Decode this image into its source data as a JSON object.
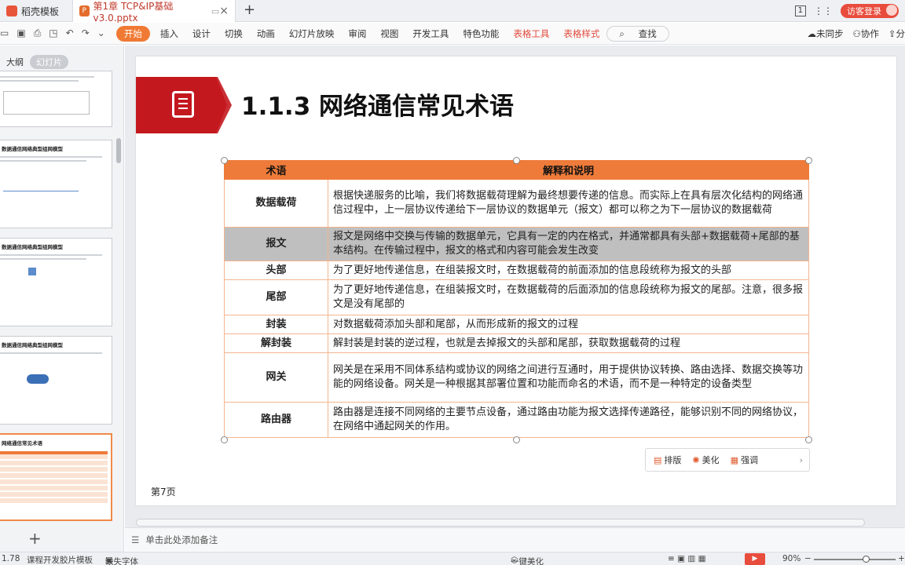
{
  "tabs": [
    {
      "label": "稻壳模板"
    },
    {
      "label": "第1章 TCP&IP基础v3.0.pptx",
      "icon_text": "P"
    }
  ],
  "window": {
    "page_indicator": "1",
    "login_label": "访客登录"
  },
  "ribbon": {
    "start": "开始",
    "menus": [
      "插入",
      "设计",
      "切换",
      "动画",
      "幻灯片放映",
      "审阅",
      "视图",
      "开发工具",
      "特色功能"
    ],
    "context_tabs": [
      "表格工具",
      "表格样式"
    ],
    "search": "查找",
    "right": [
      "未同步",
      "协作",
      "分"
    ]
  },
  "left_panel": {
    "tabs": [
      "大纲",
      "幻灯片"
    ],
    "thumbnails": [
      {
        "title": ""
      },
      {
        "title": "数据通信网络典型组网模型"
      },
      {
        "title": "数据通信网络典型组网模型"
      },
      {
        "title": "数据通信网络典型组网模型"
      },
      {
        "title": "网络通信常见术语"
      }
    ]
  },
  "slide": {
    "title": "1.1.3 网络通信常见术语",
    "page_label": "第7页",
    "table": {
      "headers": [
        "术语",
        "解释和说明"
      ],
      "rows": [
        {
          "term": "数据载荷",
          "desc": "根据快递服务的比喻，我们将数据载荷理解为最终想要传递的信息。而实际上在具有层次化结构的网络通信过程中，上一层协议传递给下一层协议的数据单元（报文）都可以称之为下一层协议的数据载荷"
        },
        {
          "term": "报文",
          "desc": "报文是网络中交换与传输的数据单元，它具有一定的内在格式，并通常都具有头部+数据载荷+尾部的基本结构。在传输过程中，报文的格式和内容可能会发生改变"
        },
        {
          "term": "头部",
          "desc": "为了更好地传递信息，在组装报文时，在数据载荷的前面添加的信息段统称为报文的头部"
        },
        {
          "term": "尾部",
          "desc": "为了更好地传递信息，在组装报文时，在数据载荷的后面添加的信息段统称为报文的尾部。注意，很多报文是没有尾部的"
        },
        {
          "term": "封装",
          "desc": "对数据载荷添加头部和尾部，从而形成新的报文的过程"
        },
        {
          "term": "解封装",
          "desc": "解封装是封装的逆过程，也就是去掉报文的头部和尾部，获取数据载荷的过程"
        },
        {
          "term": "网关",
          "desc": "网关是在采用不同体系结构或协议的网络之间进行互通时，用于提供协议转换、路由选择、数据交换等功能的网络设备。网关是一种根据其部署位置和功能而命名的术语，而不是一种特定的设备类型"
        },
        {
          "term": "路由器",
          "desc": "路由器是连接不同网络的主要节点设备，通过路由功能为报文选择传递路径，能够识别不同的网络协议，在网络中通起网关的作用。"
        }
      ]
    },
    "float_toolbar": [
      "排版",
      "美化",
      "强调"
    ]
  },
  "notes_placeholder": "单击此处添加备注",
  "status": {
    "left_num": "1.78",
    "template": "课程开发胶片模板",
    "missing_font": "缺失字体",
    "beautify": "一键美化",
    "zoom": "90%"
  }
}
